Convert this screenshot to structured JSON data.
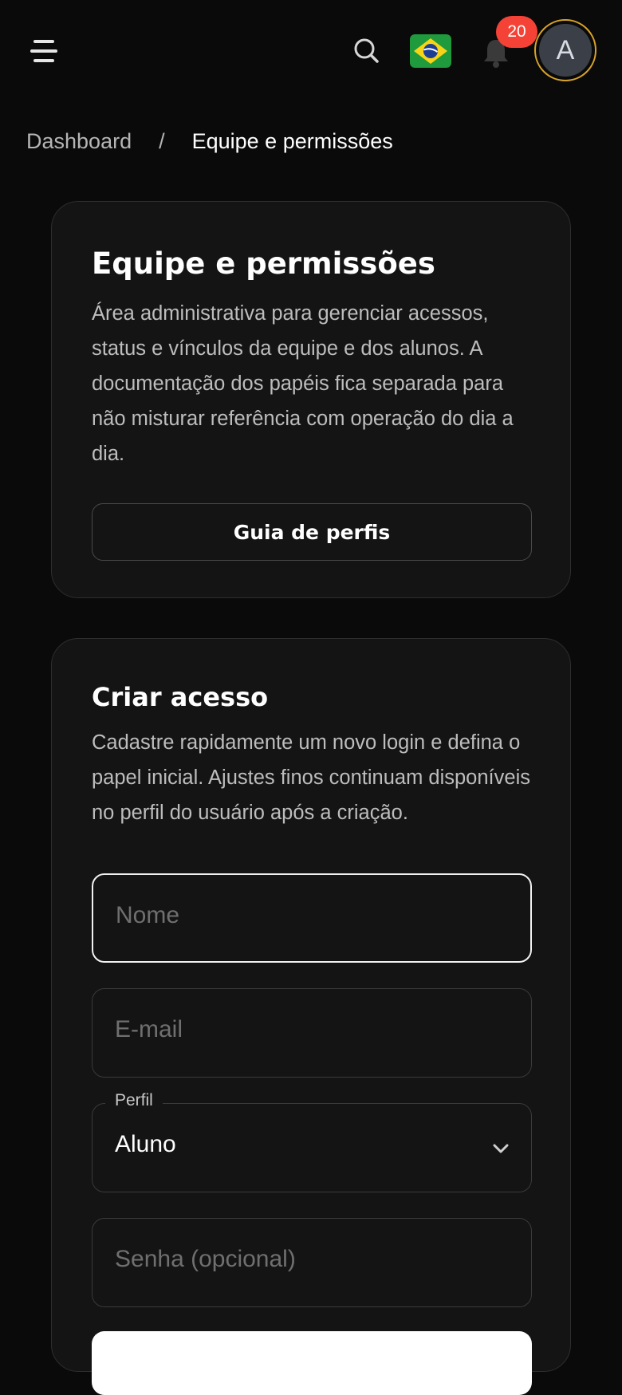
{
  "header": {
    "menu_icon": "hamburger-menu-icon",
    "search_icon": "search-icon",
    "flag_icon": "brazil-flag-icon",
    "bell_icon": "bell-icon",
    "notification_count": "20",
    "avatar_initial": "A",
    "colors": {
      "badge": "#f44336",
      "avatar_ring": "#d8a32a",
      "avatar_bg": "#3b4048"
    }
  },
  "breadcrumb": {
    "items": [
      "Dashboard",
      "Equipe e permissões"
    ],
    "separator": "/"
  },
  "intro_card": {
    "title": "Equipe e permissões",
    "description": "Área administrativa para gerenciar acessos, status e vínculos da equipe e dos alunos. A documentação dos papéis fica separada para não misturar referência com operação do dia a dia.",
    "button_label": "Guia de perfis"
  },
  "create_card": {
    "title": "Criar acesso",
    "description": "Cadastre rapidamente um novo login e defina o papel inicial. Ajustes finos continuam disponíveis no perfil do usuário após a criação.",
    "fields": {
      "name_placeholder": "Nome",
      "email_placeholder": "E-mail",
      "profile_label": "Perfil",
      "profile_value": "Aluno",
      "password_placeholder": "Senha (opcional)"
    }
  }
}
